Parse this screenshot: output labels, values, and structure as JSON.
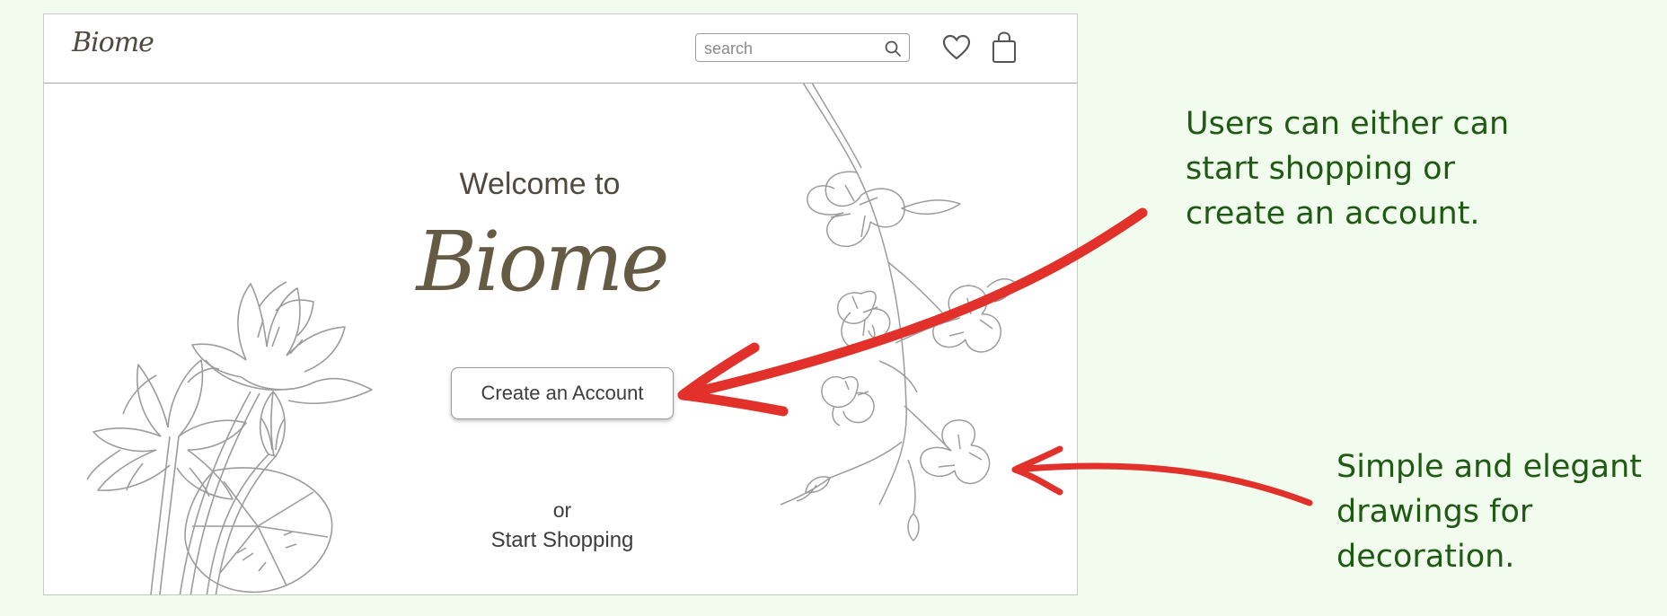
{
  "header": {
    "logo": "Biome",
    "search": {
      "placeholder": "search"
    }
  },
  "hero": {
    "welcome": "Welcome to",
    "brand": "Biome",
    "create_account_label": "Create an Account",
    "or_label": "or",
    "start_shopping_label": "Start Shopping"
  },
  "annotations": [
    {
      "lines": [
        "Users can either can",
        "start shopping or",
        "create an account."
      ]
    },
    {
      "lines": [
        "Simple and elegant",
        "drawings for",
        "decoration."
      ]
    }
  ],
  "icons": {
    "search": "search-icon",
    "favorites": "heart-icon",
    "cart": "shopping-bag-icon"
  },
  "colors": {
    "page_background": "#f1fbee",
    "annotation_text": "#1e5a12",
    "annotation_arrow": "#e2302a",
    "brand_text": "#655b45",
    "line_art": "#9c9c9c"
  }
}
